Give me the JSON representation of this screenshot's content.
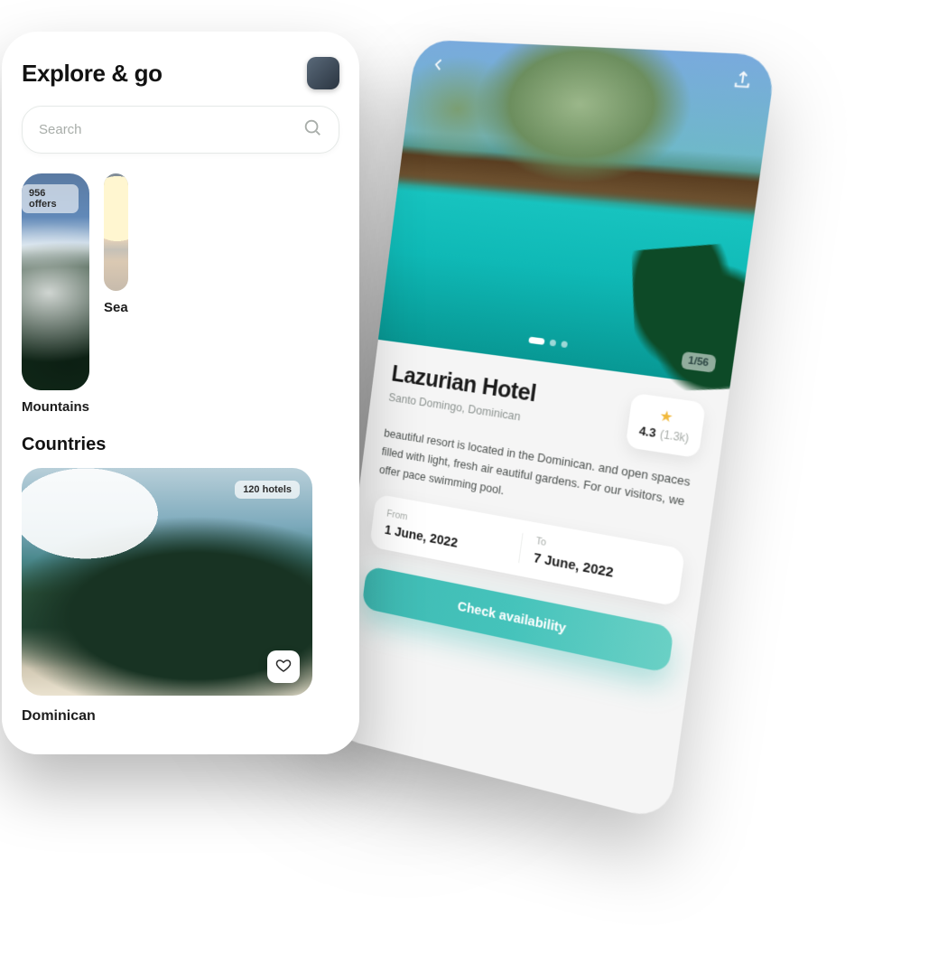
{
  "explore": {
    "title": "Explore & go",
    "search_placeholder": "Search",
    "categories": [
      {
        "label": "Mountains",
        "offers": "956 offers"
      },
      {
        "label": "Sea"
      }
    ],
    "countries_title": "Countries",
    "country": {
      "label": "Dominican",
      "hotels": "120 hotels"
    }
  },
  "detail": {
    "counter": "1/56",
    "name": "Lazurian Hotel",
    "location": "Santo Domingo, Dominican",
    "rating": "4.3",
    "rating_count": "(1.3k)",
    "description": "beautiful resort is located in the Dominican.  and open spaces filled with light, fresh air eautiful gardens. For our visitors, we offer pace swimming pool.",
    "from_label": "From",
    "from_date": "1 June, 2022",
    "to_label": "To",
    "to_date": "7 June, 2022",
    "cta": "Check availability"
  }
}
